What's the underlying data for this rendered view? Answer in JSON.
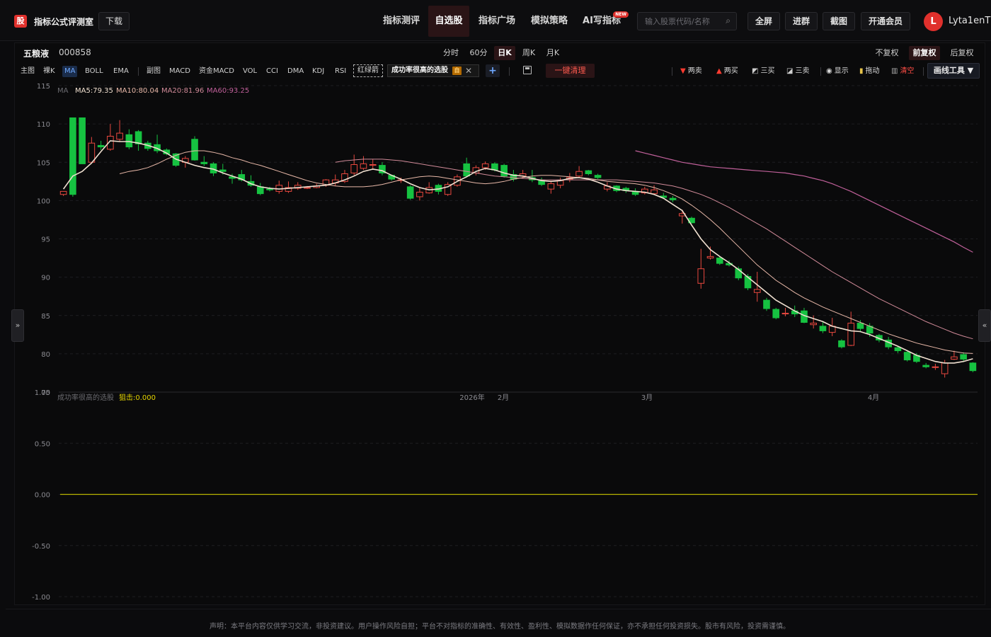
{
  "app": {
    "logo_text": "股",
    "title": "指标公式评测室",
    "download_label": "下载"
  },
  "nav": {
    "items": [
      {
        "label": "指标测评",
        "active": false
      },
      {
        "label": "自选股",
        "active": true
      },
      {
        "label": "指标广场",
        "active": false
      },
      {
        "label": "模拟策略",
        "active": false
      },
      {
        "label": "AI写指标",
        "active": false,
        "badge": "NEW"
      }
    ]
  },
  "search": {
    "placeholder": "输入股票代码/名称",
    "value": ""
  },
  "toolbar": {
    "fullscreen": "全屏",
    "join_group": "进群",
    "screenshot": "截图",
    "vip": "开通会员"
  },
  "user": {
    "avatar_letter": "L",
    "name": "Lyta1enT"
  },
  "stock": {
    "name": "五粮液",
    "code": "000858"
  },
  "periods": [
    {
      "label": "分时",
      "active": false
    },
    {
      "label": "60分",
      "active": false
    },
    {
      "label": "日K",
      "active": true
    },
    {
      "label": "周K",
      "active": false
    },
    {
      "label": "月K",
      "active": false
    }
  ],
  "adjust": [
    {
      "label": "不复权",
      "active": false
    },
    {
      "label": "前复权",
      "active": true
    },
    {
      "label": "后复权",
      "active": false
    }
  ],
  "indicators": {
    "main_label": "主图",
    "main": [
      "裸K",
      "MA",
      "BOLL",
      "EMA"
    ],
    "main_active": "MA",
    "sub_label": "副图",
    "sub": [
      "MACD",
      "资金MACD",
      "VOL",
      "CCI",
      "DMA",
      "KDJ",
      "RSI"
    ],
    "custom_label": "红绿箭",
    "selected_formula": "成功率很高的选股",
    "selected_tag": "自",
    "add_icon": "+",
    "clean_label": "一键清理"
  },
  "draw_tools": {
    "two_sell": "两卖",
    "two_buy": "两买",
    "three_buy": "三买",
    "three_sell": "三卖",
    "show": "显示",
    "drag": "拖动",
    "clear": "清空",
    "draw_tool": "画线工具 ▼"
  },
  "ma_legend": {
    "label": "MA",
    "items": [
      {
        "text": "MA5:79.35",
        "color": "#f0e0d0"
      },
      {
        "text": "MA10:80.04",
        "color": "#e8b8a8"
      },
      {
        "text": "MA20:81.96",
        "color": "#d08a98"
      },
      {
        "text": "MA60:93.25",
        "color": "#c0609a"
      }
    ]
  },
  "sub_legend": {
    "name": "成功率很高的选股",
    "value_text": "狙击:0.000",
    "value_color": "#e6d600"
  },
  "chart_data": {
    "type": "candlestick",
    "y_axis_main": {
      "ticks": [
        115,
        110,
        105,
        100,
        95,
        90,
        85,
        80,
        75
      ],
      "range": [
        75,
        115
      ]
    },
    "y_axis_sub": {
      "ticks": [
        "1.00",
        "0.50",
        "0.00",
        "-0.50",
        "-1.00"
      ],
      "range": [
        -1.0,
        1.0
      ]
    },
    "x_labels": [
      "2026年",
      "2月",
      "3月",
      "4月"
    ],
    "candles": [
      [
        100.8,
        101.2,
        100.6,
        101.0
      ],
      [
        110.8,
        100.8,
        110.8,
        100.5
      ],
      [
        110.8,
        104.8,
        110.8,
        104.8
      ],
      [
        105.0,
        107.5,
        108.3,
        104.8
      ],
      [
        107.2,
        107.0,
        107.8,
        106.6
      ],
      [
        106.7,
        108.4,
        110.0,
        106.5
      ],
      [
        108.0,
        108.8,
        110.5,
        107.7
      ],
      [
        108.6,
        107.0,
        109.3,
        106.7
      ],
      [
        109.0,
        107.4,
        109.2,
        106.5
      ],
      [
        107.5,
        106.8,
        107.8,
        106.5
      ],
      [
        107.3,
        106.5,
        108.6,
        106.2
      ],
      [
        106.6,
        106.1,
        106.8,
        105.9
      ],
      [
        106.1,
        104.6,
        106.2,
        104.4
      ],
      [
        105.0,
        105.5,
        105.8,
        104.3
      ],
      [
        108.0,
        105.3,
        108.4,
        105.2
      ],
      [
        105.0,
        104.8,
        105.8,
        104.5
      ],
      [
        104.8,
        103.6,
        105.0,
        103.2
      ],
      [
        104.0,
        103.8,
        104.8,
        103.4
      ],
      [
        103.1,
        102.9,
        103.5,
        102.2
      ],
      [
        103.4,
        102.7,
        104.0,
        102.5
      ],
      [
        102.5,
        102.0,
        103.3,
        101.8
      ],
      [
        101.8,
        100.9,
        102.3,
        100.7
      ],
      [
        101.5,
        101.4,
        101.8,
        101.2
      ],
      [
        101.2,
        102.0,
        102.6,
        100.9
      ],
      [
        101.2,
        101.7,
        102.5,
        101.0
      ],
      [
        101.6,
        102.0,
        102.4,
        101.4
      ],
      [
        101.6,
        101.7,
        101.9,
        101.5
      ],
      [
        101.7,
        101.9,
        102.2,
        101.6
      ],
      [
        102.0,
        102.7,
        102.8,
        101.8
      ],
      [
        102.3,
        102.7,
        103.4,
        101.9
      ],
      [
        102.5,
        103.5,
        104.0,
        102.3
      ],
      [
        103.6,
        104.7,
        106.0,
        103.3
      ],
      [
        104.2,
        104.8,
        105.8,
        104.0
      ],
      [
        104.6,
        104.7,
        105.4,
        104.0
      ],
      [
        104.6,
        103.6,
        105.0,
        103.3
      ],
      [
        103.3,
        102.8,
        103.4,
        102.6
      ],
      [
        102.7,
        102.7,
        103.0,
        102.3
      ],
      [
        101.8,
        100.3,
        102.0,
        100.1
      ],
      [
        100.5,
        101.1,
        101.6,
        100.0
      ],
      [
        101.0,
        101.7,
        102.4,
        100.9
      ],
      [
        102.0,
        101.2,
        102.2,
        100.8
      ],
      [
        100.8,
        102.1,
        102.4,
        100.6
      ],
      [
        102.0,
        103.1,
        103.4,
        101.8
      ],
      [
        104.8,
        103.2,
        105.6,
        103.0
      ],
      [
        103.6,
        104.3,
        104.6,
        103.3
      ],
      [
        104.3,
        104.8,
        105.1,
        104.0
      ],
      [
        104.8,
        104.0,
        105.0,
        103.8
      ],
      [
        104.6,
        103.2,
        104.8,
        103.0
      ],
      [
        103.4,
        102.8,
        104.0,
        102.5
      ],
      [
        103.2,
        103.5,
        104.0,
        102.9
      ],
      [
        103.0,
        102.7,
        104.0,
        102.4
      ],
      [
        102.6,
        102.1,
        103.0,
        101.9
      ],
      [
        101.5,
        102.2,
        102.6,
        100.9
      ],
      [
        102.0,
        102.6,
        103.0,
        101.6
      ],
      [
        102.8,
        103.0,
        103.6,
        102.4
      ],
      [
        103.2,
        103.8,
        104.5,
        103.0
      ],
      [
        103.9,
        103.5,
        104.0,
        103.3
      ],
      [
        103.3,
        103.0,
        103.5,
        102.8
      ],
      [
        101.5,
        101.9,
        102.4,
        101.2
      ],
      [
        101.9,
        101.3,
        102.0,
        101.1
      ],
      [
        101.6,
        101.3,
        101.8,
        101.0
      ],
      [
        101.2,
        100.8,
        101.6,
        100.6
      ],
      [
        101.0,
        101.5,
        101.8,
        100.8
      ],
      [
        100.9,
        101.4,
        102.0,
        100.8
      ],
      [
        100.6,
        100.4,
        101.0,
        100.2
      ],
      [
        100.3,
        100.1,
        100.6,
        99.8
      ],
      [
        98.0,
        98.3,
        98.8,
        97.0
      ],
      [
        97.7,
        97.1,
        97.9,
        97.0
      ],
      [
        89.2,
        91.1,
        93.7,
        88.5
      ],
      [
        92.5,
        92.7,
        94.0,
        92.3
      ],
      [
        92.5,
        91.8,
        92.8,
        91.6
      ],
      [
        91.8,
        91.6,
        92.2,
        91.4
      ],
      [
        91.1,
        89.9,
        91.4,
        89.6
      ],
      [
        90.1,
        88.6,
        90.4,
        88.3
      ],
      [
        88.0,
        88.4,
        90.7,
        86.8
      ],
      [
        87.0,
        85.9,
        87.3,
        85.6
      ],
      [
        85.8,
        84.7,
        86.0,
        84.5
      ],
      [
        85.2,
        85.3,
        86.0,
        84.9
      ],
      [
        85.6,
        85.2,
        86.3,
        84.8
      ],
      [
        85.6,
        84.1,
        86.0,
        84.0
      ],
      [
        83.8,
        84.0,
        85.0,
        83.3
      ],
      [
        83.6,
        83.0,
        84.2,
        82.7
      ],
      [
        82.8,
        83.6,
        84.7,
        82.3
      ],
      [
        81.7,
        80.9,
        81.9,
        80.7
      ],
      [
        81.1,
        84.0,
        85.5,
        81.0
      ],
      [
        84.0,
        83.3,
        84.4,
        82.9
      ],
      [
        83.6,
        82.7,
        84.0,
        82.2
      ],
      [
        82.4,
        81.8,
        82.6,
        81.5
      ],
      [
        81.8,
        80.9,
        82.2,
        80.6
      ],
      [
        80.8,
        80.4,
        81.0,
        80.1
      ],
      [
        80.2,
        79.2,
        80.4,
        79.0
      ],
      [
        79.8,
        79.0,
        80.1,
        78.8
      ],
      [
        78.5,
        78.3,
        78.8,
        78.1
      ],
      [
        78.3,
        78.3,
        78.7,
        77.9
      ],
      [
        77.4,
        78.8,
        79.2,
        76.9
      ],
      [
        79.3,
        79.6,
        80.4,
        79.2
      ],
      [
        79.9,
        79.3,
        80.2,
        79.0
      ],
      [
        78.8,
        77.8,
        78.9,
        77.6
      ]
    ],
    "ma5": [
      101.5,
      103.2,
      103.8,
      104.9,
      106.4,
      107.8,
      107.7,
      107.7,
      107.5,
      107.2,
      106.8,
      106.2,
      105.4,
      105.0,
      104.6,
      104.3,
      104.1,
      103.6,
      103.2,
      102.8,
      102.2,
      101.8,
      101.6,
      101.5,
      101.6,
      101.7,
      101.8,
      101.9,
      102.0,
      102.3,
      102.7,
      103.2,
      103.8,
      104.1,
      103.9,
      103.3,
      102.8,
      102.2,
      101.7,
      101.4,
      101.5,
      101.8,
      102.5,
      103.1,
      103.8,
      104.2,
      104.0,
      103.6,
      103.3,
      103.2,
      102.9,
      102.6,
      102.5,
      102.6,
      102.9,
      103.0,
      102.8,
      102.4,
      101.9,
      101.5,
      101.3,
      101.2,
      101.1,
      100.8,
      100.3,
      99.5,
      98.7,
      96.8,
      95.0,
      93.6,
      92.7,
      91.9,
      91.0,
      90.0,
      89.0,
      88.0,
      87.0,
      86.3,
      85.6,
      85.0,
      84.6,
      84.2,
      83.6,
      83.3,
      83.0,
      82.9,
      82.5,
      82.0,
      81.5,
      81.0,
      80.4,
      79.8,
      79.4,
      79.0,
      78.8,
      78.8,
      79.0,
      79.35
    ],
    "ma10": [
      103.5,
      103.8,
      104.0,
      104.3,
      104.8,
      105.4,
      105.9,
      106.3,
      106.5,
      106.5,
      106.3,
      106.0,
      105.6,
      105.3,
      104.9,
      104.6,
      104.2,
      103.8,
      103.4,
      103.0,
      102.6,
      102.3,
      102.1,
      101.9,
      101.8,
      101.8,
      101.8,
      101.9,
      102.1,
      102.4,
      102.7,
      102.9,
      103.1,
      103.2,
      103.1,
      102.9,
      102.7,
      102.5,
      102.3,
      102.2,
      102.3,
      102.5,
      102.8,
      103.0,
      103.2,
      103.3,
      103.3,
      103.2,
      103.1,
      103.0,
      102.9,
      102.7,
      102.5,
      102.4,
      102.3,
      102.2,
      102.0,
      101.7,
      101.3,
      100.8,
      100.2,
      99.4,
      98.5,
      97.5,
      96.4,
      95.2,
      94.0,
      92.8,
      91.6,
      90.6,
      89.6,
      88.8,
      88.0,
      87.3,
      86.7,
      86.1,
      85.6,
      85.1,
      84.6,
      84.1,
      83.6,
      83.1,
      82.6,
      82.2,
      81.8,
      81.4,
      81.1,
      80.8,
      80.5,
      80.3,
      80.1,
      80.04
    ],
    "ma20": [
      105.0,
      105.2,
      105.3,
      105.4,
      105.4,
      105.4,
      105.3,
      105.2,
      105.0,
      104.8,
      104.6,
      104.4,
      104.2,
      104.0,
      103.8,
      103.6,
      103.4,
      103.2,
      103.1,
      103.0,
      102.9,
      102.8,
      102.7,
      102.7,
      102.7,
      102.7,
      102.7,
      102.7,
      102.7,
      102.7,
      102.7,
      102.6,
      102.5,
      102.4,
      102.3,
      102.1,
      101.9,
      101.6,
      101.2,
      100.8,
      100.3,
      99.7,
      99.1,
      98.4,
      97.7,
      97.0,
      96.3,
      95.5,
      94.7,
      93.9,
      93.1,
      92.3,
      91.5,
      90.7,
      90.0,
      89.3,
      88.6,
      87.9,
      87.2,
      86.6,
      86.0,
      85.4,
      84.8,
      84.2,
      83.7,
      83.2,
      82.7,
      82.3,
      81.96
    ],
    "ma60": [
      106.5,
      106.2,
      105.9,
      105.6,
      105.3,
      105.0,
      104.8,
      104.6,
      104.4,
      104.3,
      104.2,
      104.1,
      104.0,
      103.9,
      103.8,
      103.7,
      103.6,
      103.4,
      103.2,
      102.9,
      102.6,
      102.2,
      101.7,
      101.2,
      100.6,
      100.0,
      99.4,
      98.8,
      98.2,
      97.6,
      97.0,
      96.4,
      95.8,
      95.2,
      94.6,
      93.9,
      93.25
    ]
  },
  "side": {
    "left_icon": "»",
    "right_icon": "«"
  },
  "footer": {
    "disclaimer": "声明：本平台内容仅供学习交流，非投资建议。用户操作风险自担；平台不对指标的准确性、有效性、盈利性、模拟数据作任何保证，亦不承担任何投资损失。股市有风险，投资需谨慎。"
  }
}
